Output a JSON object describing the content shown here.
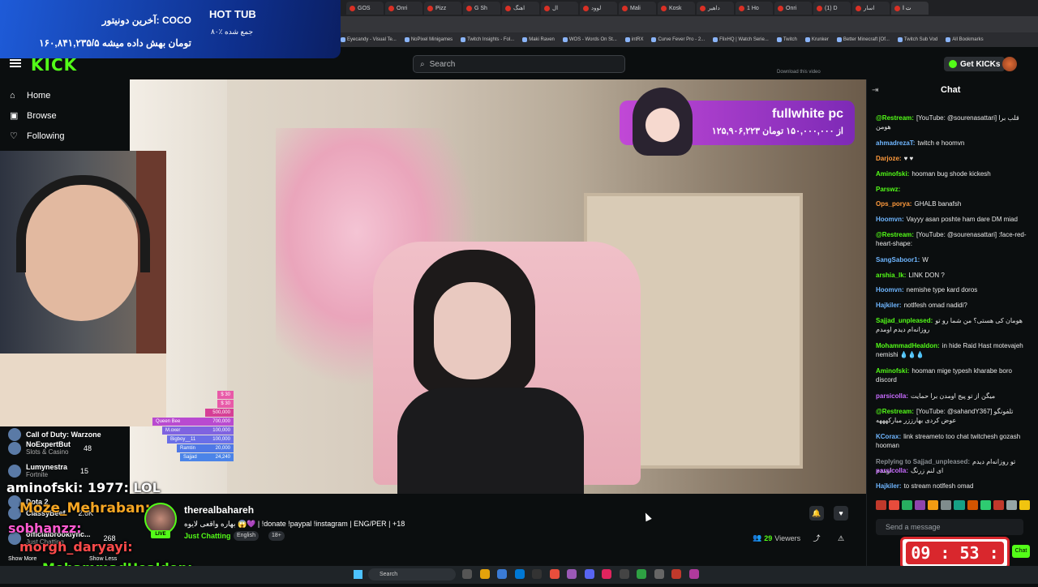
{
  "browser": {
    "tabs": [
      "GOS",
      "Onri",
      "Pizz",
      "G Sh",
      "اهنگ",
      "ال",
      "لو‌ود",
      "Mali",
      "Kosk",
      "داهير",
      "1 Ho",
      "Onri",
      "(1) D",
      "اسار",
      "ت ا"
    ],
    "bookmarks": [
      "Eyecandy - Visual Te...",
      "NoPixel Minigames",
      "Twitch Insights - Fol...",
      "Maki Raven",
      "WOS - Words On St...",
      "intRX",
      "Curve Fever Pro - 2...",
      "FlixHQ | Watch Serie...",
      "Twitch",
      "Krunker",
      "Better Minecraft [Of...",
      "Twitch Sub Vod",
      "All Bookmarks"
    ]
  },
  "donation_overlay": {
    "last_donor_label": "آخرین دونیتور: COCO",
    "total_text": "۱۶۰,۸۴۱,۲۳۵/۵ تومان بهش داده میشه",
    "title": "HOT TUB",
    "subtitle": "۸۰٪ جمع شده"
  },
  "header": {
    "logo": "KICK",
    "search_placeholder": "Search",
    "get_kicks": "Get KICKs"
  },
  "sidebar": {
    "items": [
      {
        "label": "Home",
        "icon": "home-icon"
      },
      {
        "label": "Browse",
        "icon": "browse-icon"
      },
      {
        "label": "Following",
        "icon": "heart-icon"
      }
    ],
    "channels": [
      {
        "name": "Call of Duty: Warzone",
        "game": "",
        "viewers": ""
      },
      {
        "name": "NoExpertBut",
        "game": "Slots & Casino",
        "viewers": "48"
      },
      {
        "name": "Lumynestra",
        "game": "Fortnite",
        "viewers": "15"
      },
      {
        "name": "Dota 2",
        "game": "",
        "viewers": ""
      },
      {
        "name": "ClassyBeef",
        "game": "",
        "viewers": "2.6K"
      },
      {
        "name": "officialbrooklync...",
        "game": "Just Chatting",
        "viewers": "268"
      }
    ],
    "show_more": "Show More",
    "show_less": "Show Less"
  },
  "overlay_chat": [
    {
      "text": "aminofski: 1977: LOL",
      "color": "#ffffff"
    },
    {
      "text": "Moze_Mehraban:",
      "color": "#f5a623"
    },
    {
      "text": "sobhanzz:",
      "color": "#ff5ad1"
    },
    {
      "text": "morgh_daryayi:",
      "color": "#ff4b4b"
    },
    {
      "text": "MohammadHealdon:",
      "color": "#53fc18"
    }
  ],
  "leaderboard": [
    {
      "name": "",
      "amount": "$ 30"
    },
    {
      "name": "",
      "amount": "$ 30"
    },
    {
      "name": "",
      "amount": "500,000"
    },
    {
      "name": "Queen Bee",
      "amount": "700,000"
    },
    {
      "name": "M.oxer",
      "amount": "100,000"
    },
    {
      "name": "Bigboy__11",
      "amount": "100,000"
    },
    {
      "name": "Ramtin",
      "amount": "20,000"
    },
    {
      "name": "Sajjad",
      "amount": "24,240"
    }
  ],
  "video": {
    "banner_title": "fullwhite pc",
    "banner_sub": "۱۲۵,۹۰۶,۲۲۳ از ۱۵۰,۰۰۰,۰۰۰ تومان",
    "download_hint": "Download this video"
  },
  "stream": {
    "streamer": "therealbahareh",
    "live": "LIVE",
    "title": "بهاره واقعی لایوه 😱💜 | !donate !paypal !instagram | ENG/PER | +18",
    "category": "Just Chatting",
    "tags": [
      "English",
      "18+"
    ],
    "viewers": "29",
    "viewers_label": "Viewers"
  },
  "chat": {
    "title": "Chat",
    "input_placeholder": "Send a message",
    "messages": [
      {
        "user": "@Restream:",
        "color": "#53fc18",
        "text": "[YouTube: @sourenasattari] قلب برا هومن"
      },
      {
        "user": "ahmadrezaT:",
        "color": "#6fb6ff",
        "text": "twitch e hoomvn"
      },
      {
        "user": "Darjoze:",
        "color": "#ff9a3c",
        "text": "♥ ♥"
      },
      {
        "user": "Aminofski:",
        "color": "#53fc18",
        "text": "hooman bug shode kickesh"
      },
      {
        "user": "Parswz:",
        "color": "#53fc18",
        "text": ""
      },
      {
        "user": "Ops_porya:",
        "color": "#ff9a3c",
        "text": "GHALB banafsh"
      },
      {
        "user": "Hoomvn:",
        "color": "#6fb6ff",
        "text": "Vayyy asan poshte ham dare DM miad"
      },
      {
        "user": "@Restream:",
        "color": "#53fc18",
        "text": "[YouTube: @sourenasattari] :face-red-heart-shape:"
      },
      {
        "user": "SangSaboor1:",
        "color": "#6fb6ff",
        "text": "W"
      },
      {
        "user": "arshia_lk:",
        "color": "#53fc18",
        "text": "LINK DON ?"
      },
      {
        "user": "Hoomvn:",
        "color": "#6fb6ff",
        "text": "nemishe type kard doros"
      },
      {
        "user": "Hajkiler:",
        "color": "#6fb6ff",
        "text": "notlfesh omad nadidi?"
      },
      {
        "user": "Sajjad_unpleased:",
        "color": "#53fc18",
        "text": "هومان کی هستی؟ من شما رو تو روزانه‌ام دیدم اومدم"
      },
      {
        "user": "MohammadHealdon:",
        "color": "#53fc18",
        "text": "in hide Raid Hast motevajeh nemishi 💧💧💧"
      },
      {
        "user": "Aminofski:",
        "color": "#53fc18",
        "text": "hooman mige typesh kharabe boro discord"
      },
      {
        "user": "parsicolla:",
        "color": "#c86bff",
        "text": "میگن از تو پیج اومدن برا حمایت"
      },
      {
        "user": "@Restream:",
        "color": "#53fc18",
        "text": "[YouTube: @sahandY367] تلفونگو عوض کردی بهارززر مبارکهههه"
      },
      {
        "user": "KCorax:",
        "color": "#6fb6ff",
        "text": "link streameto too chat twitchesh gozash hooman"
      },
      {
        "user": "Replying to Sajjad_unpleased:",
        "color": "#8a8f94",
        "text": "تو روزانه‌ام دیدم اومدم"
      },
      {
        "user": "parsicolla:",
        "color": "#c86bff",
        "text": "ای لنم زرنگ"
      },
      {
        "user": "Hajkiler:",
        "color": "#6fb6ff",
        "text": "to stream notlfesh omad"
      }
    ]
  },
  "timer": {
    "value": "09 : 53 : 55",
    "send_label": "Chat"
  },
  "taskbar": {
    "search": "Search"
  }
}
